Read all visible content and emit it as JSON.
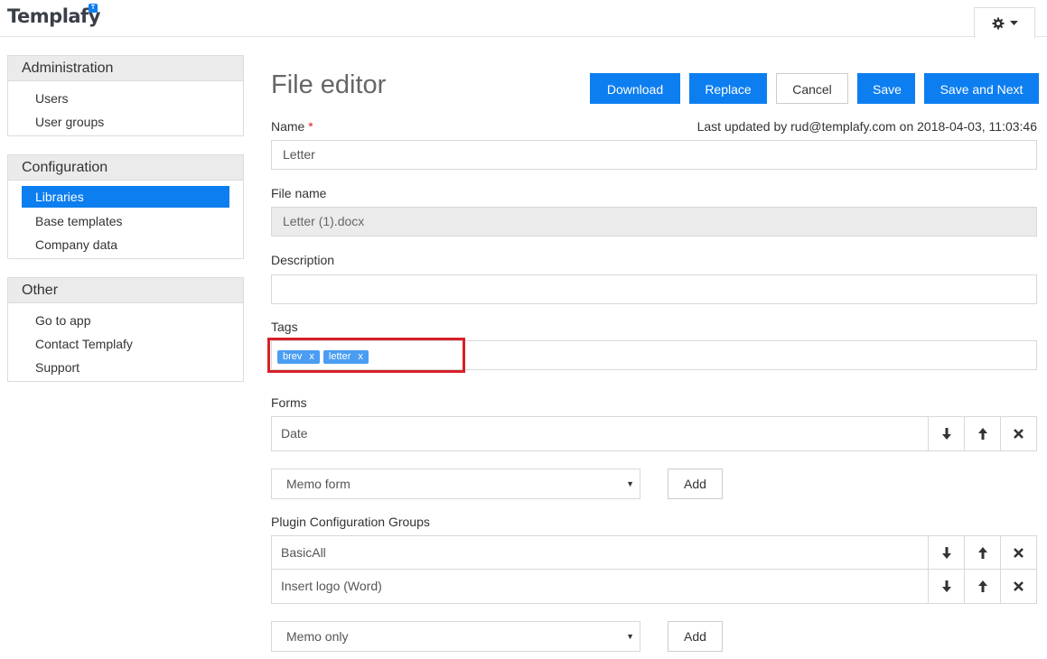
{
  "app": {
    "logo_text": "Templafy",
    "logo_badge": "T"
  },
  "topbar": {
    "settings_icon": "gear-icon",
    "dropdown_icon": "caret-down-icon"
  },
  "sidebar": {
    "administration": {
      "title": "Administration",
      "items": [
        {
          "label": "Users"
        },
        {
          "label": "User groups"
        }
      ]
    },
    "configuration": {
      "title": "Configuration",
      "items": [
        {
          "label": "Libraries",
          "active": true
        },
        {
          "label": "Base templates"
        },
        {
          "label": "Company data"
        }
      ]
    },
    "other": {
      "title": "Other",
      "items": [
        {
          "label": "Go to app"
        },
        {
          "label": "Contact Templafy"
        },
        {
          "label": "Support"
        }
      ]
    }
  },
  "main": {
    "title": "File editor",
    "buttons": {
      "download": "Download",
      "replace": "Replace",
      "cancel": "Cancel",
      "save": "Save",
      "save_next": "Save and Next"
    },
    "last_updated": "Last updated by rud@templafy.com on 2018-04-03, 11:03:46",
    "name": {
      "label": "Name",
      "required_mark": "*",
      "value": "Letter"
    },
    "file_name": {
      "label": "File name",
      "value": "Letter (1).docx"
    },
    "description": {
      "label": "Description",
      "value": ""
    },
    "tags": {
      "label": "Tags",
      "items": [
        {
          "label": "brev",
          "remove": "x"
        },
        {
          "label": "letter",
          "remove": "x"
        }
      ]
    },
    "forms": {
      "label": "Forms",
      "rows": [
        {
          "label": "Date"
        }
      ],
      "select_value": "Memo form",
      "add_label": "Add"
    },
    "plugin_groups": {
      "label": "Plugin Configuration Groups",
      "rows": [
        {
          "label": "BasicAll"
        },
        {
          "label": "Insert logo (Word)"
        }
      ],
      "select_value": "Memo only",
      "add_label": "Add"
    }
  },
  "colors": {
    "accent": "#0d7ef0",
    "tag": "#4a9df2",
    "highlight": "#d62029",
    "required": "#e02020"
  }
}
